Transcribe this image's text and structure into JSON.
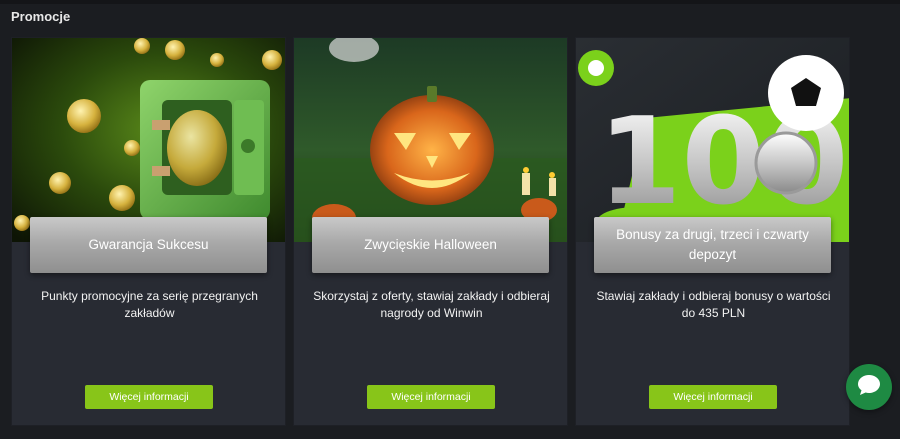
{
  "page": {
    "section_title": "Promocje"
  },
  "cards": [
    {
      "title": "Gwarancja Sukcesu",
      "description": "Punkty promocyjne za serię przegranych zakładów",
      "button_label": "Więcej informacji"
    },
    {
      "title": "Zwycięskie Halloween",
      "description": "Skorzystaj z oferty, stawiaj zakłady i odbieraj nagrody od Winwin",
      "button_label": "Więcej informacji"
    },
    {
      "title": "Bonusy za drugi, trzeci i czwarty depozyt",
      "description": "Stawiaj zakłady i odbieraj bonusy o wartości do 435 PLN",
      "button_label": "Więcej informacji",
      "banner_text": "100"
    }
  ],
  "chat": {
    "icon": "chat-bubble-icon"
  },
  "colors": {
    "background": "#1b1d21",
    "card": "#282b33",
    "accent_button": "#88c519",
    "chat_button": "#1e8a43"
  }
}
